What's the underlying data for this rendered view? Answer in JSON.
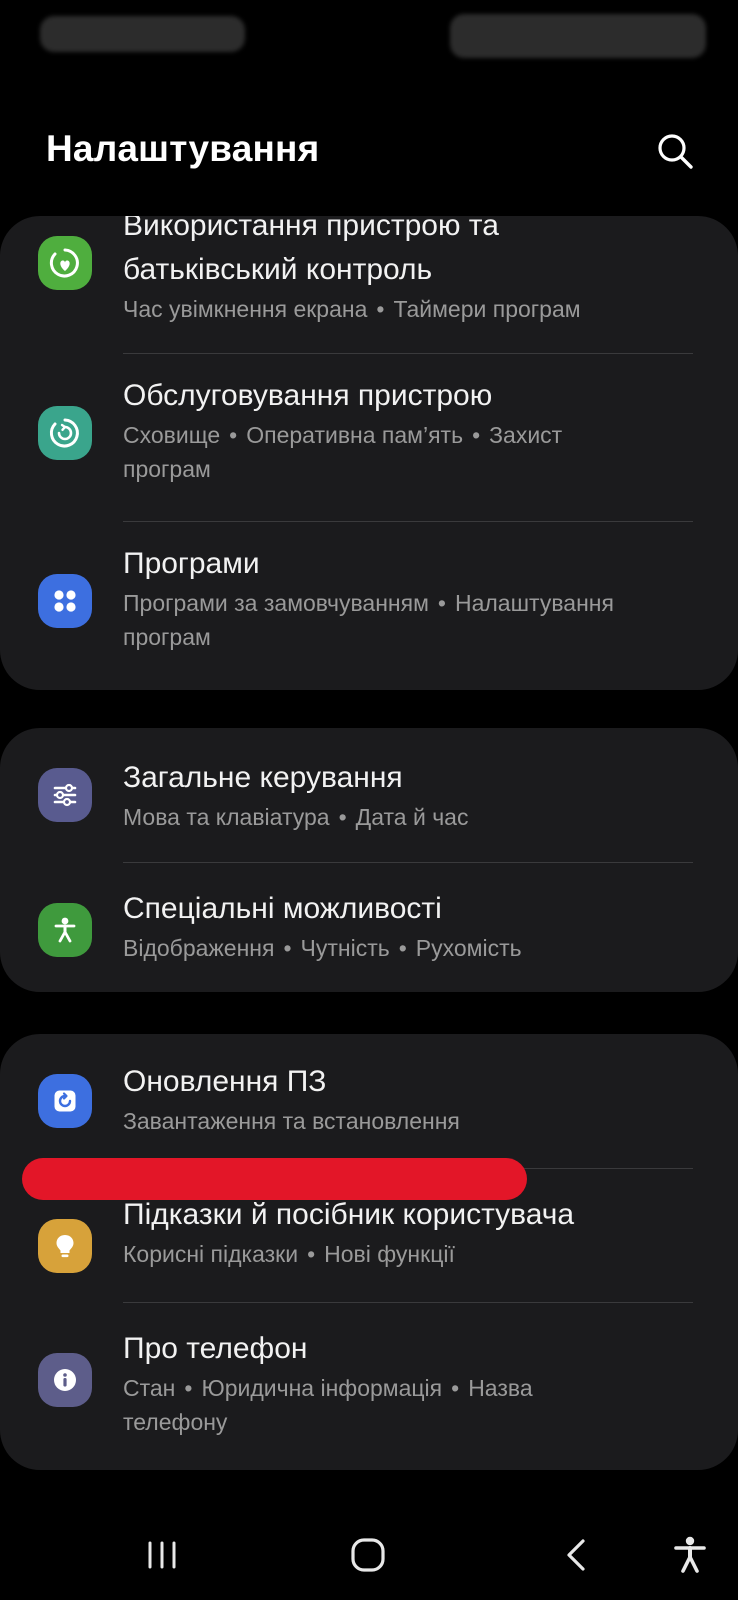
{
  "header": {
    "title": "Налаштування"
  },
  "icons": {
    "search": "search-icon"
  },
  "colors": {
    "card_bg": "#1b1b1d",
    "digital_wellbeing": "#4fae3e",
    "device_care": "#3aa58c",
    "apps": "#3d6fe0",
    "general_management": "#595b8f",
    "accessibility": "#3f9a3d",
    "software_update": "#3d6fe0",
    "tips": "#d7a23a",
    "about_phone": "#5d5d8a",
    "redaction": "#e31628"
  },
  "groups": [
    {
      "items": [
        {
          "title_line1": "Використання пристрою та",
          "title_line2": "батьківський контроль",
          "sub": [
            "Час увімкнення екрана",
            "Таймери програм"
          ],
          "icon": "digital-wellbeing-icon"
        },
        {
          "title": "Обслуговування пристрою",
          "sub": [
            "Сховище",
            "Оперативна пам’ять",
            "Захист"
          ],
          "sub_line2": "програм",
          "icon": "device-care-icon"
        },
        {
          "title": "Програми",
          "sub": [
            "Програми за замовчуванням",
            "Налаштування"
          ],
          "sub_line2": "програм",
          "icon": "apps-icon"
        }
      ]
    },
    {
      "items": [
        {
          "title": "Загальне керування",
          "sub": [
            "Мова та клавіатура",
            "Дата й час"
          ],
          "icon": "general-management-icon"
        },
        {
          "title": "Спеціальні можливості",
          "sub": [
            "Відображення",
            "Чутність",
            "Рухомість"
          ],
          "icon": "accessibility-icon"
        }
      ]
    },
    {
      "items": [
        {
          "title": "Оновлення ПЗ",
          "sub": [
            "Завантаження та встановлення"
          ],
          "icon": "software-update-icon"
        },
        {
          "title": "Підказки й посібник користувача",
          "sub": [
            "Корисні підказки",
            "Нові функції"
          ],
          "icon": "lightbulb-icon"
        },
        {
          "title": "Про телефон",
          "sub": [
            "Стан",
            "Юридична інформація",
            "Назва"
          ],
          "sub_line2": "телефону",
          "icon": "info-icon"
        }
      ]
    }
  ],
  "navbar": {
    "recents": "recents-icon",
    "home": "home-icon",
    "back": "back-icon",
    "accessibility": "accessibility-shortcut-icon"
  }
}
